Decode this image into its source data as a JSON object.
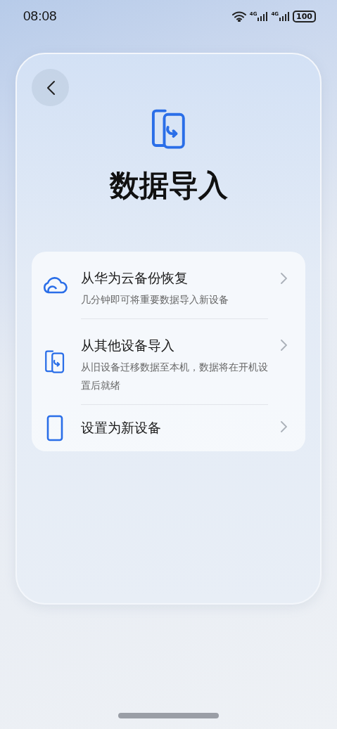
{
  "status_bar": {
    "time": "08:08",
    "sim1": "4G",
    "sim2": "4G",
    "battery": "100"
  },
  "header": {
    "title": "数据导入"
  },
  "options": [
    {
      "kind": "cloud",
      "title": "从华为云备份恢复",
      "subtitle": "几分钟即可将重要数据导入新设备"
    },
    {
      "kind": "transfer",
      "title": "从其他设备导入",
      "subtitle": "从旧设备迁移数据至本机，数据将在开机设置后就绪"
    },
    {
      "kind": "phone",
      "title": "设置为新设备"
    }
  ]
}
